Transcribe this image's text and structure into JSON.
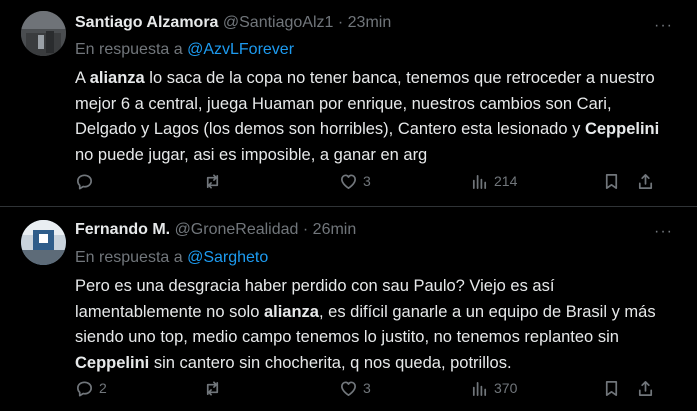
{
  "tweets": [
    {
      "name": "Santiago Alzamora",
      "handle": "@SantiagoAlz1",
      "separator": "·",
      "time": "23min",
      "more": "···",
      "reply_prefix": "En respuesta a",
      "reply_to": "@AzvLForever",
      "body": [
        {
          "t": "A ",
          "b": false
        },
        {
          "t": "alianza",
          "b": true
        },
        {
          "t": " lo saca de la copa no tener banca, tenemos que retroceder a nuestro mejor 6 a central, juega Huaman por enrique, nuestros cambios son Cari, Delgado y Lagos (los demos son horribles), Cantero esta lesionado y ",
          "b": false
        },
        {
          "t": "Ceppelini",
          "b": true
        },
        {
          "t": " no puede jugar, asi es imposible, a ganar en arg",
          "b": false
        }
      ],
      "reply_count": "",
      "retweet_count": "",
      "like_count": "3",
      "view_count": "214"
    },
    {
      "name": "Fernando M.",
      "handle": "@GroneRealidad",
      "separator": "·",
      "time": "26min",
      "more": "···",
      "reply_prefix": "En respuesta a",
      "reply_to": "@Sargheto",
      "body": [
        {
          "t": "Pero es una desgracia haber perdido con sau Paulo? Viejo es así lamentablemente no solo ",
          "b": false
        },
        {
          "t": "alianza",
          "b": true
        },
        {
          "t": ", es difícil ganarle a un equipo de Brasil y más siendo uno top, medio campo tenemos lo justito, no tenemos replanteo sin ",
          "b": false
        },
        {
          "t": "Ceppelini",
          "b": true
        },
        {
          "t": " sin cantero sin chocherita, q nos queda, potrillos.",
          "b": false
        }
      ],
      "reply_count": "2",
      "retweet_count": "",
      "like_count": "3",
      "view_count": "370"
    }
  ],
  "icons": [
    "reply-icon",
    "retweet-icon",
    "like-icon",
    "views-icon",
    "bookmark-icon",
    "share-icon",
    "more-icon"
  ],
  "colors": {
    "background": "#000000",
    "text": "#e7e9ea",
    "muted": "#71767b",
    "link": "#1d9bf0",
    "divider": "#2f3336"
  }
}
